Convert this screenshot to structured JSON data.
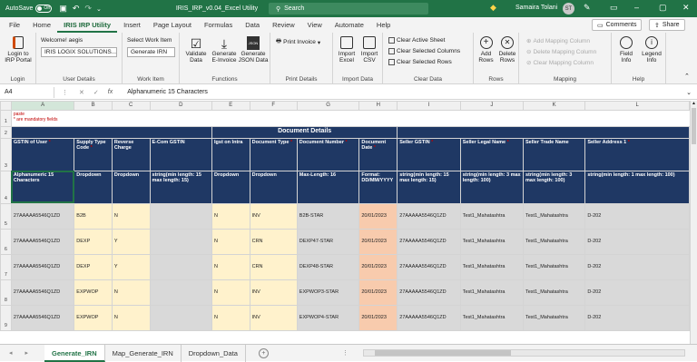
{
  "titlebar": {
    "autosave_label": "AutoSave",
    "autosave_state": "Off",
    "filename": "IRIS_IRP_v0.04_Excel Utility",
    "search_placeholder": "Search",
    "user_name": "Samaira Tolani",
    "user_initials": "ST"
  },
  "menu": {
    "tabs": [
      "File",
      "Home",
      "IRIS IRP Utility",
      "Insert",
      "Page Layout",
      "Formulas",
      "Data",
      "Review",
      "View",
      "Automate",
      "Help"
    ],
    "active_index": 2,
    "comments_label": "Comments",
    "share_label": "Share"
  },
  "ribbon": {
    "login": {
      "label1": "Login to",
      "label2": "IRP Portal",
      "group": "Login"
    },
    "user_details": {
      "welcome": "Welcome! aegis",
      "company": "IRIS LOGIX SOLUTIONS...",
      "group": "User Details"
    },
    "work_item": {
      "label": "Select Work Item",
      "value": "Generate IRN",
      "group": "Work Item"
    },
    "functions": {
      "buttons": [
        {
          "l1": "Validate",
          "l2": "Data"
        },
        {
          "l1": "Generate",
          "l2": "E-Invoice"
        },
        {
          "l1": "Generate",
          "l2": "JSON Data"
        }
      ],
      "group": "Functions"
    },
    "print": {
      "label": "Print Invoice",
      "group": "Print Details"
    },
    "import": {
      "buttons": [
        {
          "l1": "Import",
          "l2": "Excel"
        },
        {
          "l1": "Import",
          "l2": "CSV"
        }
      ],
      "group": "Import Data"
    },
    "clear": {
      "items": [
        "Clear Active Sheet",
        "Clear Selected Columns",
        "Clear Selected Rows"
      ],
      "group": "Clear Data"
    },
    "rows": {
      "buttons": [
        {
          "l1": "Add",
          "l2": "Rows"
        },
        {
          "l1": "Delete",
          "l2": "Rows"
        }
      ],
      "group": "Rows"
    },
    "mapping": {
      "items": [
        "Add Mapping Column",
        "Delete Mapping Column",
        "Clear Mapping Column"
      ],
      "group": "Mapping"
    },
    "help": {
      "buttons": [
        {
          "l1": "Field",
          "l2": "Info"
        },
        {
          "l1": "Legend",
          "l2": "Info"
        }
      ],
      "group": "Help"
    }
  },
  "formula_bar": {
    "cell_ref": "A4",
    "fx": "fx",
    "content": "Alphanumeric 15 Characters"
  },
  "sheet": {
    "columns": [
      "A",
      "B",
      "C",
      "D",
      "E",
      "F",
      "G",
      "H",
      "I",
      "J",
      "K",
      "L"
    ],
    "note1": "paste",
    "note2": "* are mandatory fields",
    "section_title": "Document Details",
    "headers": [
      "GSTIN of User",
      "Supply Type Code",
      "Reverse Charge",
      "E-Com GSTIN",
      "Igst on Intra",
      "Document Type",
      "Document Number",
      "Document Date",
      "Seller GSTIN",
      "Seller Legal Name",
      "Seller Trade Name",
      "Seller Address 1"
    ],
    "formats": [
      "Alphanumeric 15 Characters",
      "Dropdown",
      "Dropdown",
      "string(min length: 15 max length: 15)",
      "Dropdown",
      "Dropdown",
      "Max-Length: 16",
      "Format: DD/MM/YYYY",
      "string(min length: 15 max length: 15)",
      "string(min length: 3 max length: 100)",
      "string(min length: 3 max length: 100)",
      "string(min length: 1 max length: 100)"
    ],
    "data_rows": [
      {
        "row": "5",
        "cells": [
          "27AAAAA5546Q1ZD",
          "B2B",
          "N",
          "",
          "N",
          "INV",
          "B2B-STAR",
          "20/01/2023",
          "27AAAAA5546Q1ZD",
          "Test1_Mahatashtra",
          "Test1_Mahatashtra",
          "D-202"
        ]
      },
      {
        "row": "6",
        "cells": [
          "27AAAAA5546Q1ZD",
          "DEXP",
          "Y",
          "",
          "N",
          "CRN",
          "DEXP47-STAR",
          "20/01/2023",
          "27AAAAA5546Q1ZD",
          "Test1_Mahatashtra",
          "Test1_Mahatashtra",
          "D-202"
        ]
      },
      {
        "row": "7",
        "cells": [
          "27AAAAA5546Q1ZD",
          "DEXP",
          "Y",
          "",
          "N",
          "CRN",
          "DEXP48-STAR",
          "20/01/2023",
          "27AAAAA5546Q1ZD",
          "Test1_Mahatashtra",
          "Test1_Mahatashtra",
          "D-202"
        ]
      },
      {
        "row": "8",
        "cells": [
          "27AAAAA5546Q1ZD",
          "EXPWOP",
          "N",
          "",
          "N",
          "INV",
          "EXPWOP3-STAR",
          "20/01/2023",
          "27AAAAA5546Q1ZD",
          "Test1_Mahatashtra",
          "Test1_Mahatashtra",
          "D-202"
        ]
      },
      {
        "row": "9",
        "cells": [
          "27AAAAA5546Q1ZD",
          "EXPWOP",
          "N",
          "",
          "N",
          "INV",
          "EXPWOP4-STAR",
          "20/01/2023",
          "27AAAAA5546Q1ZD",
          "Test1_Mahatashtra",
          "Test1_Mahatashtra",
          "D-202"
        ]
      }
    ]
  },
  "sheet_tabs": [
    "Generate_IRN",
    "Map_Generate_IRN",
    "Dropdown_Data"
  ],
  "active_sheet": 0,
  "colors": {
    "excel_green": "#217346",
    "header_navy": "#1f3864",
    "yellow": "#fff2cc",
    "peach": "#f8cbad"
  }
}
